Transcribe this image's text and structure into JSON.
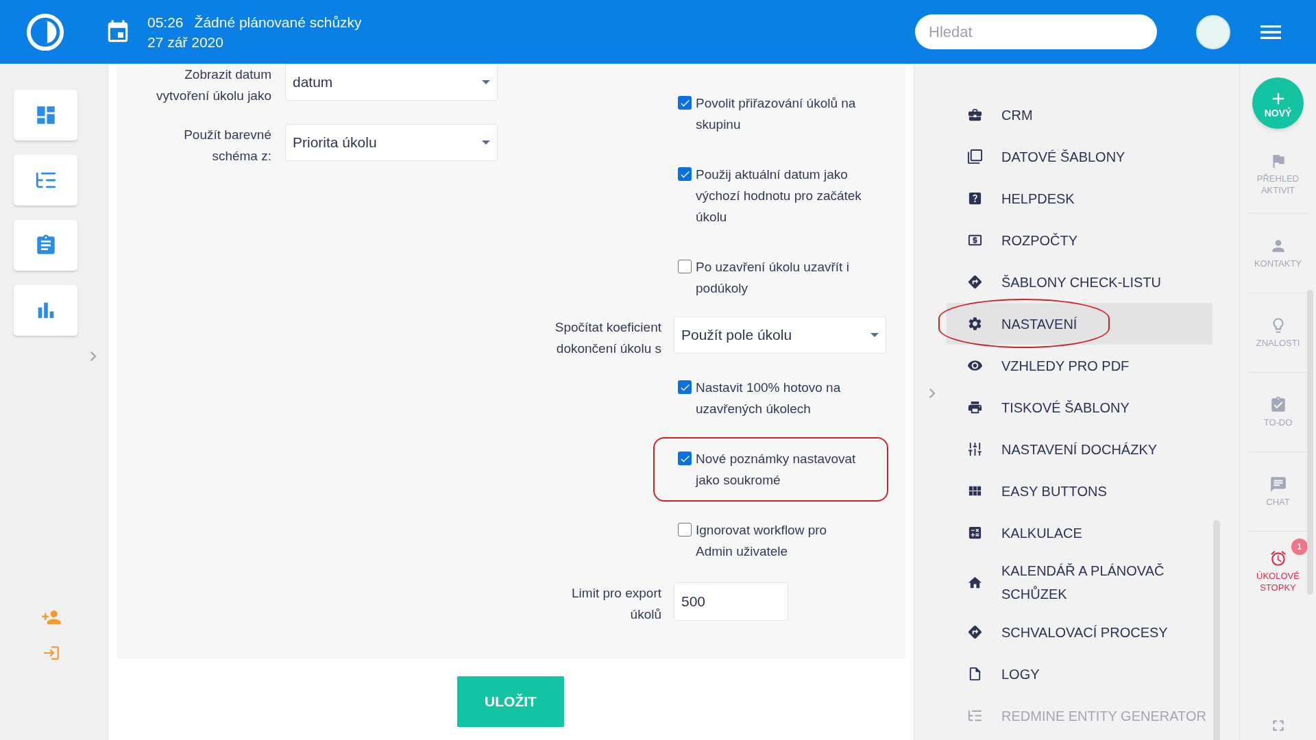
{
  "header": {
    "time": "05:26",
    "meeting": "Žádné plánované schůzky",
    "date": "27 zář 2020",
    "search": {
      "placeholder": "Hledat"
    }
  },
  "left_fields": [
    {
      "label": "Zobrazit datum vytvoření úkolu jako",
      "value": "datum"
    },
    {
      "label": "Použít barevné schéma z:",
      "value": "Priorita úkolu"
    }
  ],
  "right_fields": [
    {
      "kind": "checkbox",
      "label": "Povolit přiřazování úkolů na skupinu",
      "checked": true,
      "highlighted": false
    },
    {
      "kind": "checkbox",
      "label": "Použij aktuální datum jako výchozí hodnotu pro začátek úkolu",
      "checked": true,
      "highlighted": false
    },
    {
      "kind": "checkbox",
      "label": "Po uzavření úkolu uzavřít i podúkoly",
      "checked": false,
      "highlighted": false
    },
    {
      "kind": "select",
      "label": "Spočítat koeficient dokončení úkolu s",
      "value": "Použít pole úkolu"
    },
    {
      "kind": "checkbox",
      "label": "Nastavit 100% hotovo na uzavřených úkolech",
      "checked": true,
      "highlighted": false
    },
    {
      "kind": "checkbox",
      "label": "Nové poznámky nastavovat jako soukromé",
      "checked": true,
      "highlighted": true
    },
    {
      "kind": "checkbox",
      "label": "Ignorovat workflow pro Admin uživatele",
      "checked": false,
      "highlighted": false
    },
    {
      "kind": "input",
      "label": "Limit pro export úkolů",
      "value": "500"
    }
  ],
  "save_button": "ULOŽIT",
  "settings_menu": [
    {
      "label": "CRM",
      "selected": false,
      "highlighted": false
    },
    {
      "label": "DATOVÉ ŠABLONY",
      "selected": false,
      "highlighted": false
    },
    {
      "label": "HELPDESK",
      "selected": false,
      "highlighted": false
    },
    {
      "label": "ROZPOČTY",
      "selected": false,
      "highlighted": false
    },
    {
      "label": "ŠABLONY CHECK-LISTU",
      "selected": false,
      "highlighted": false
    },
    {
      "label": "NASTAVENÍ",
      "selected": true,
      "highlighted": true
    },
    {
      "label": "VZHLEDY PRO PDF",
      "selected": false,
      "highlighted": false
    },
    {
      "label": "TISKOVÉ ŠABLONY",
      "selected": false,
      "highlighted": false
    },
    {
      "label": "NASTAVENÍ DOCHÁZKY",
      "selected": false,
      "highlighted": false
    },
    {
      "label": "EASY BUTTONS",
      "selected": false,
      "highlighted": false
    },
    {
      "label": "KALKULACE",
      "selected": false,
      "highlighted": false
    },
    {
      "label": "KALENDÁŘ A PLÁNOVAČ SCHŮZEK",
      "selected": false,
      "highlighted": false
    },
    {
      "label": "SCHVALOVACÍ PROCESY",
      "selected": false,
      "highlighted": false
    },
    {
      "label": "LOGY",
      "selected": false,
      "highlighted": false
    },
    {
      "label": "REDMINE ENTITY GENERATOR",
      "selected": false,
      "highlighted": false
    }
  ],
  "rail": {
    "new_button": "NOVÝ",
    "items": [
      {
        "label": "PŘEHLED AKTIVIT",
        "alert": false
      },
      {
        "label": "KONTAKTY",
        "alert": false
      },
      {
        "label": "ZNALOSTI",
        "alert": false
      },
      {
        "label": "TO-DO",
        "alert": false
      },
      {
        "label": "CHAT",
        "alert": false
      },
      {
        "label": "ÚKOLOVÉ STOPKY",
        "alert": true,
        "badge": "1"
      }
    ]
  }
}
